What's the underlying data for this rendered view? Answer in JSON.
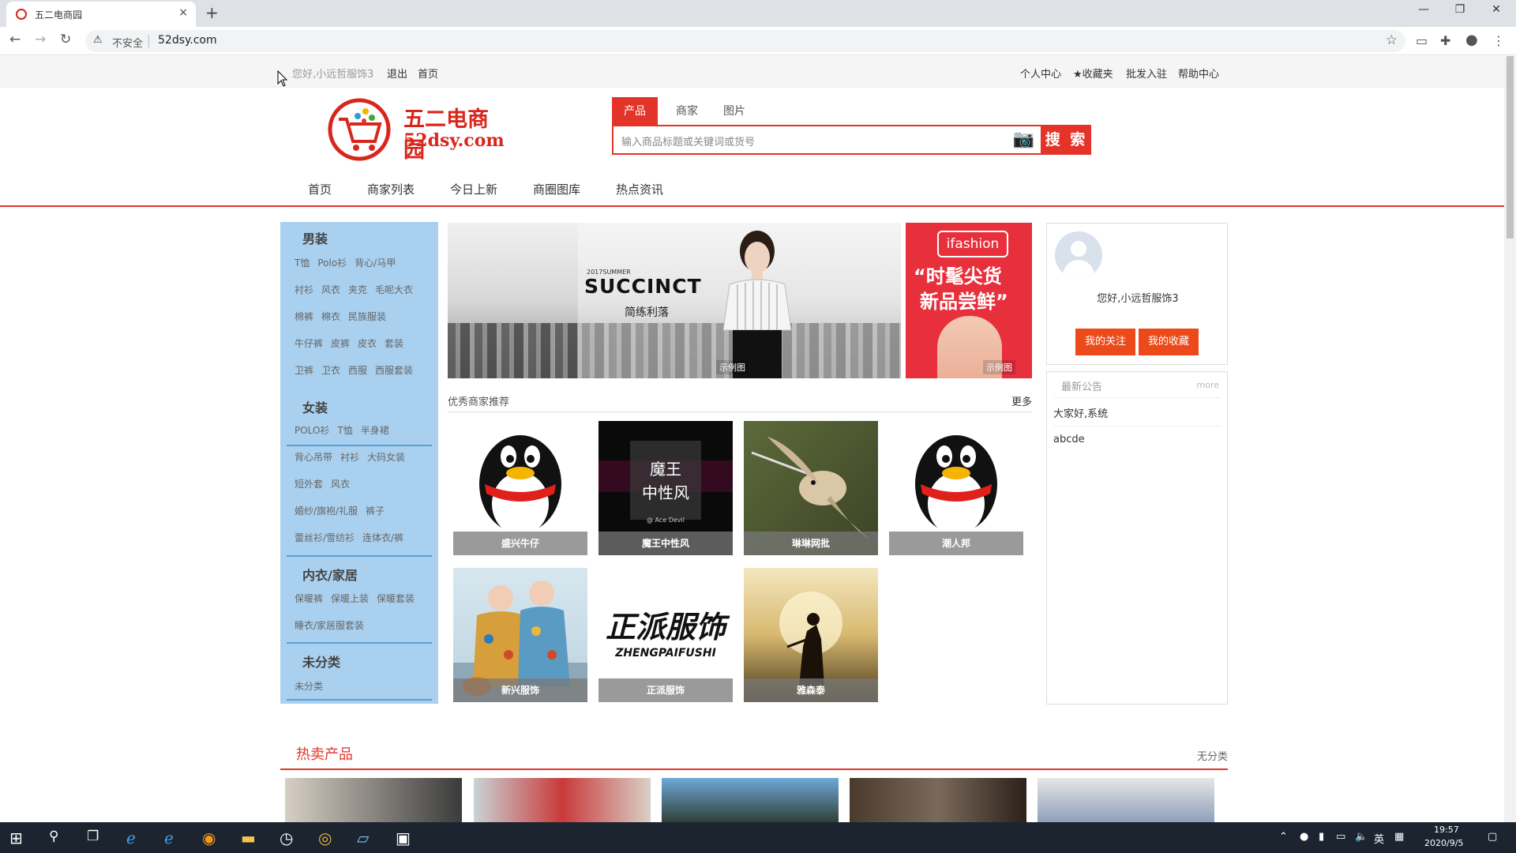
{
  "browser": {
    "tab_title": "五二电商园",
    "tab_close": "×",
    "new_tab": "+",
    "window_min": "—",
    "window_restore": "❐",
    "window_close": "✕",
    "nav_back": "←",
    "nav_forward": "→",
    "nav_reload": "↻",
    "insecure_label": "不安全",
    "url": "52dsy.com"
  },
  "topbar": {
    "greeting": "您好,小远哲服饰3",
    "logout": "退出",
    "home": "首页",
    "personal_center": "个人中心",
    "favorites": "★收藏夹",
    "wholesale_join": "批发入驻",
    "help_center": "帮助中心"
  },
  "logo": {
    "name": "五二电商园",
    "domain": "52dsy.com"
  },
  "search": {
    "tabs": [
      "产品",
      "商家",
      "图片"
    ],
    "active_tab": "产品",
    "placeholder": "输入商品标题或关键词或货号",
    "button": "搜 索"
  },
  "nav": [
    "首页",
    "商家列表",
    "今日上新",
    "商圈图库",
    "热点资讯"
  ],
  "sidebar": {
    "categories": [
      {
        "title": "男装",
        "rows": [
          [
            "T恤",
            "Polo衫",
            "背心/马甲"
          ],
          [
            "衬衫",
            "风衣",
            "夹克",
            "毛呢大衣"
          ],
          [
            "棉裤",
            "棉衣",
            "民族服装"
          ],
          [
            "牛仔裤",
            "皮裤",
            "皮衣",
            "套装"
          ],
          [
            "卫裤",
            "卫衣",
            "西服",
            "西服套装"
          ]
        ]
      },
      {
        "title": "女装",
        "rows": [
          [
            "POLO衫",
            "T恤",
            "半身裙"
          ],
          [
            "背心吊带",
            "衬衫",
            "大码女装"
          ],
          [
            "短外套",
            "风衣"
          ],
          [
            "婚纱/旗袍/礼服",
            "裤子"
          ],
          [
            "蕾丝衫/雪纺衫",
            "连体衣/裤"
          ]
        ]
      },
      {
        "title": "内衣/家居",
        "rows": [
          [
            "保暖裤",
            "保暖上装",
            "保暖套装"
          ],
          [
            "睡衣/家居服套装"
          ]
        ]
      },
      {
        "title": "未分类",
        "rows": [
          [
            "未分类"
          ]
        ]
      }
    ]
  },
  "banner_main": {
    "sub": "2017SUMMER",
    "headline": "SUCCINCT",
    "cn": "简练利落",
    "watermark": "示例图"
  },
  "banner_side": {
    "brand": "ifashion",
    "line1": "“时髦尖货",
    "line2": "新品尝鲜”",
    "watermark": "示例图"
  },
  "recommend": {
    "title": "优秀商家推荐",
    "more": "更多",
    "shops": [
      {
        "name": "盛兴牛仔",
        "img": "penguin"
      },
      {
        "name": "魔王中性风",
        "img": "devil"
      },
      {
        "name": "琳琳网批",
        "img": "bird"
      },
      {
        "name": "潮人邦",
        "img": "penguin"
      },
      {
        "name": "新兴服饰",
        "img": "couple"
      },
      {
        "name": "正派服饰",
        "img": "text"
      },
      {
        "name": "雅森泰",
        "img": "sunset"
      }
    ],
    "devil_text_1": "魔王",
    "devil_text_2": "中性风",
    "devil_sig": "@ Ace Devil",
    "zp_text": "正派服饰",
    "zp_sub": "ZHENGPAIFUSHI"
  },
  "user_panel": {
    "greeting": "您好,小远哲服饰3",
    "follow_btn": "我的关注",
    "collect_btn": "我的收藏"
  },
  "notice": {
    "title": "最新公告",
    "more": "more",
    "items": [
      "大家好,系统",
      "abcde"
    ]
  },
  "hot": {
    "title": "热卖产品",
    "right": "无分类"
  },
  "taskbar": {
    "time": "19:57",
    "date": "2020/9/5",
    "ime": "英"
  },
  "colors": {
    "brand_red": "#e4342a",
    "sidebar_blue": "#a9d0ee",
    "button_orange": "#ec4a1a"
  }
}
